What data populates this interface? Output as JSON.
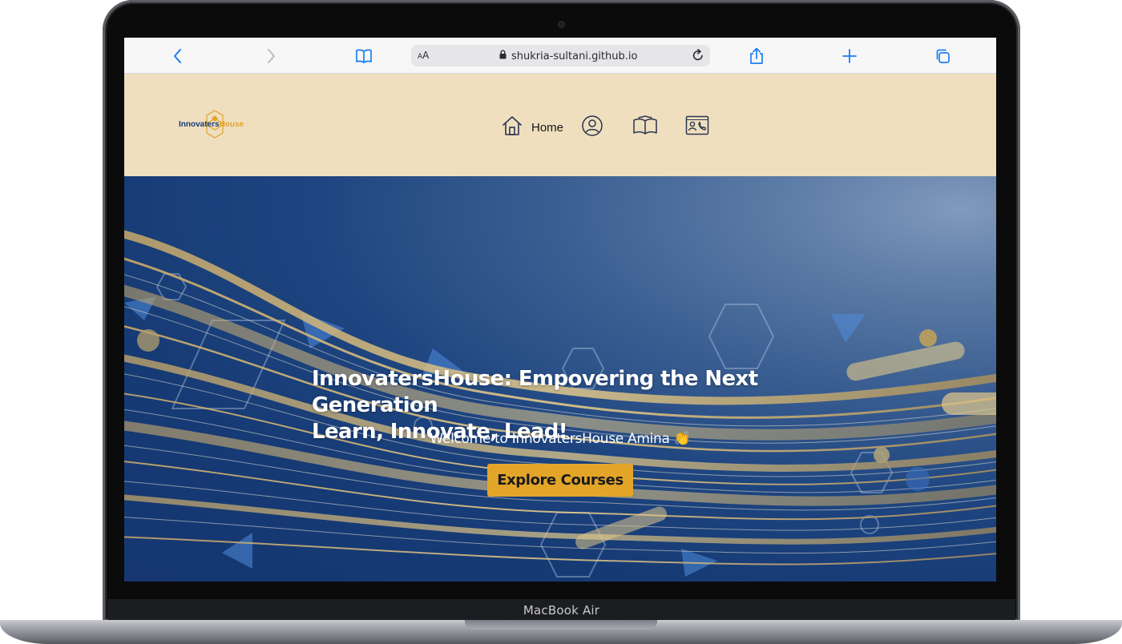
{
  "device": {
    "label": "MacBook Air"
  },
  "browser": {
    "url": "shukria-sultani.github.io",
    "text_size_label": "AA",
    "icons": [
      "chevron-left-icon",
      "chevron-right-icon",
      "book-icon",
      "lock-icon",
      "reload-icon",
      "share-icon",
      "plus-icon",
      "tabs-icon"
    ]
  },
  "site": {
    "logo": {
      "part1": "Innovaters",
      "part2": "House"
    },
    "nav": [
      {
        "label": "Home",
        "icon": "home-icon"
      },
      {
        "label": "",
        "icon": "user-circle-icon"
      },
      {
        "label": "",
        "icon": "open-book-icon"
      },
      {
        "label": "",
        "icon": "contact-card-icon"
      }
    ],
    "hero": {
      "title_line1": "InnovatersHouse: Empovering the Next Generation",
      "title_line2": "Learn, Innovate, Lead!",
      "welcome": "Welcome to InnovatersHouse Amina 👏",
      "cta_label": "Explore Courses"
    }
  },
  "colors": {
    "header_bg": "#efdfbf",
    "hero_blue": "#163a74",
    "accent_gold": "#e3a528",
    "safari_blue": "#1a7ef2"
  }
}
